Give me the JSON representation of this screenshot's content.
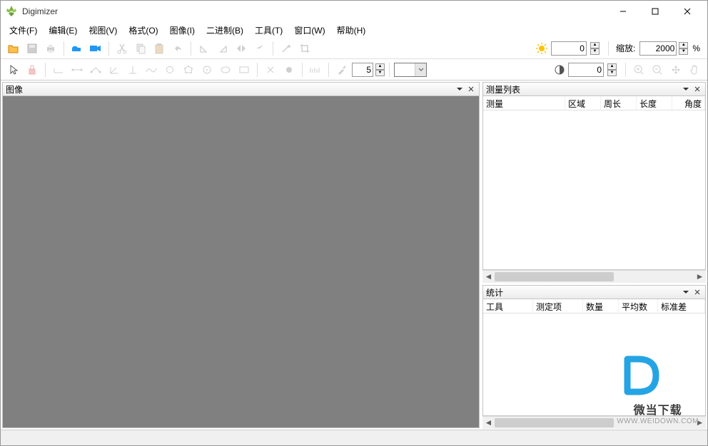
{
  "app": {
    "title": "Digimizer"
  },
  "menu": {
    "file": "文件(F)",
    "edit": "编辑(E)",
    "view": "视图(V)",
    "format": "格式(O)",
    "image": "图像(I)",
    "binary": "二进制(B)",
    "tools": "工具(T)",
    "window": "窗口(W)",
    "help": "帮助(H)"
  },
  "zoom": {
    "label": "缩放:",
    "value": "2000",
    "suffix": "%"
  },
  "brightness": {
    "value": "0"
  },
  "contrast": {
    "value": "0"
  },
  "linewidth": {
    "value": "5"
  },
  "panels": {
    "image": "图像",
    "measurements": "测量列表",
    "stats": "统计"
  },
  "measurecols": {
    "measure": "测量",
    "area": "区域",
    "perimeter": "周长",
    "length": "长度",
    "angle": "角度"
  },
  "statcols": {
    "tool": "工具",
    "item": "测定项",
    "count": "数量",
    "mean": "平均数",
    "stddev": "标准差"
  },
  "watermark": {
    "text": "微当下载",
    "url": "WWW.WEIDOWN.COM"
  }
}
